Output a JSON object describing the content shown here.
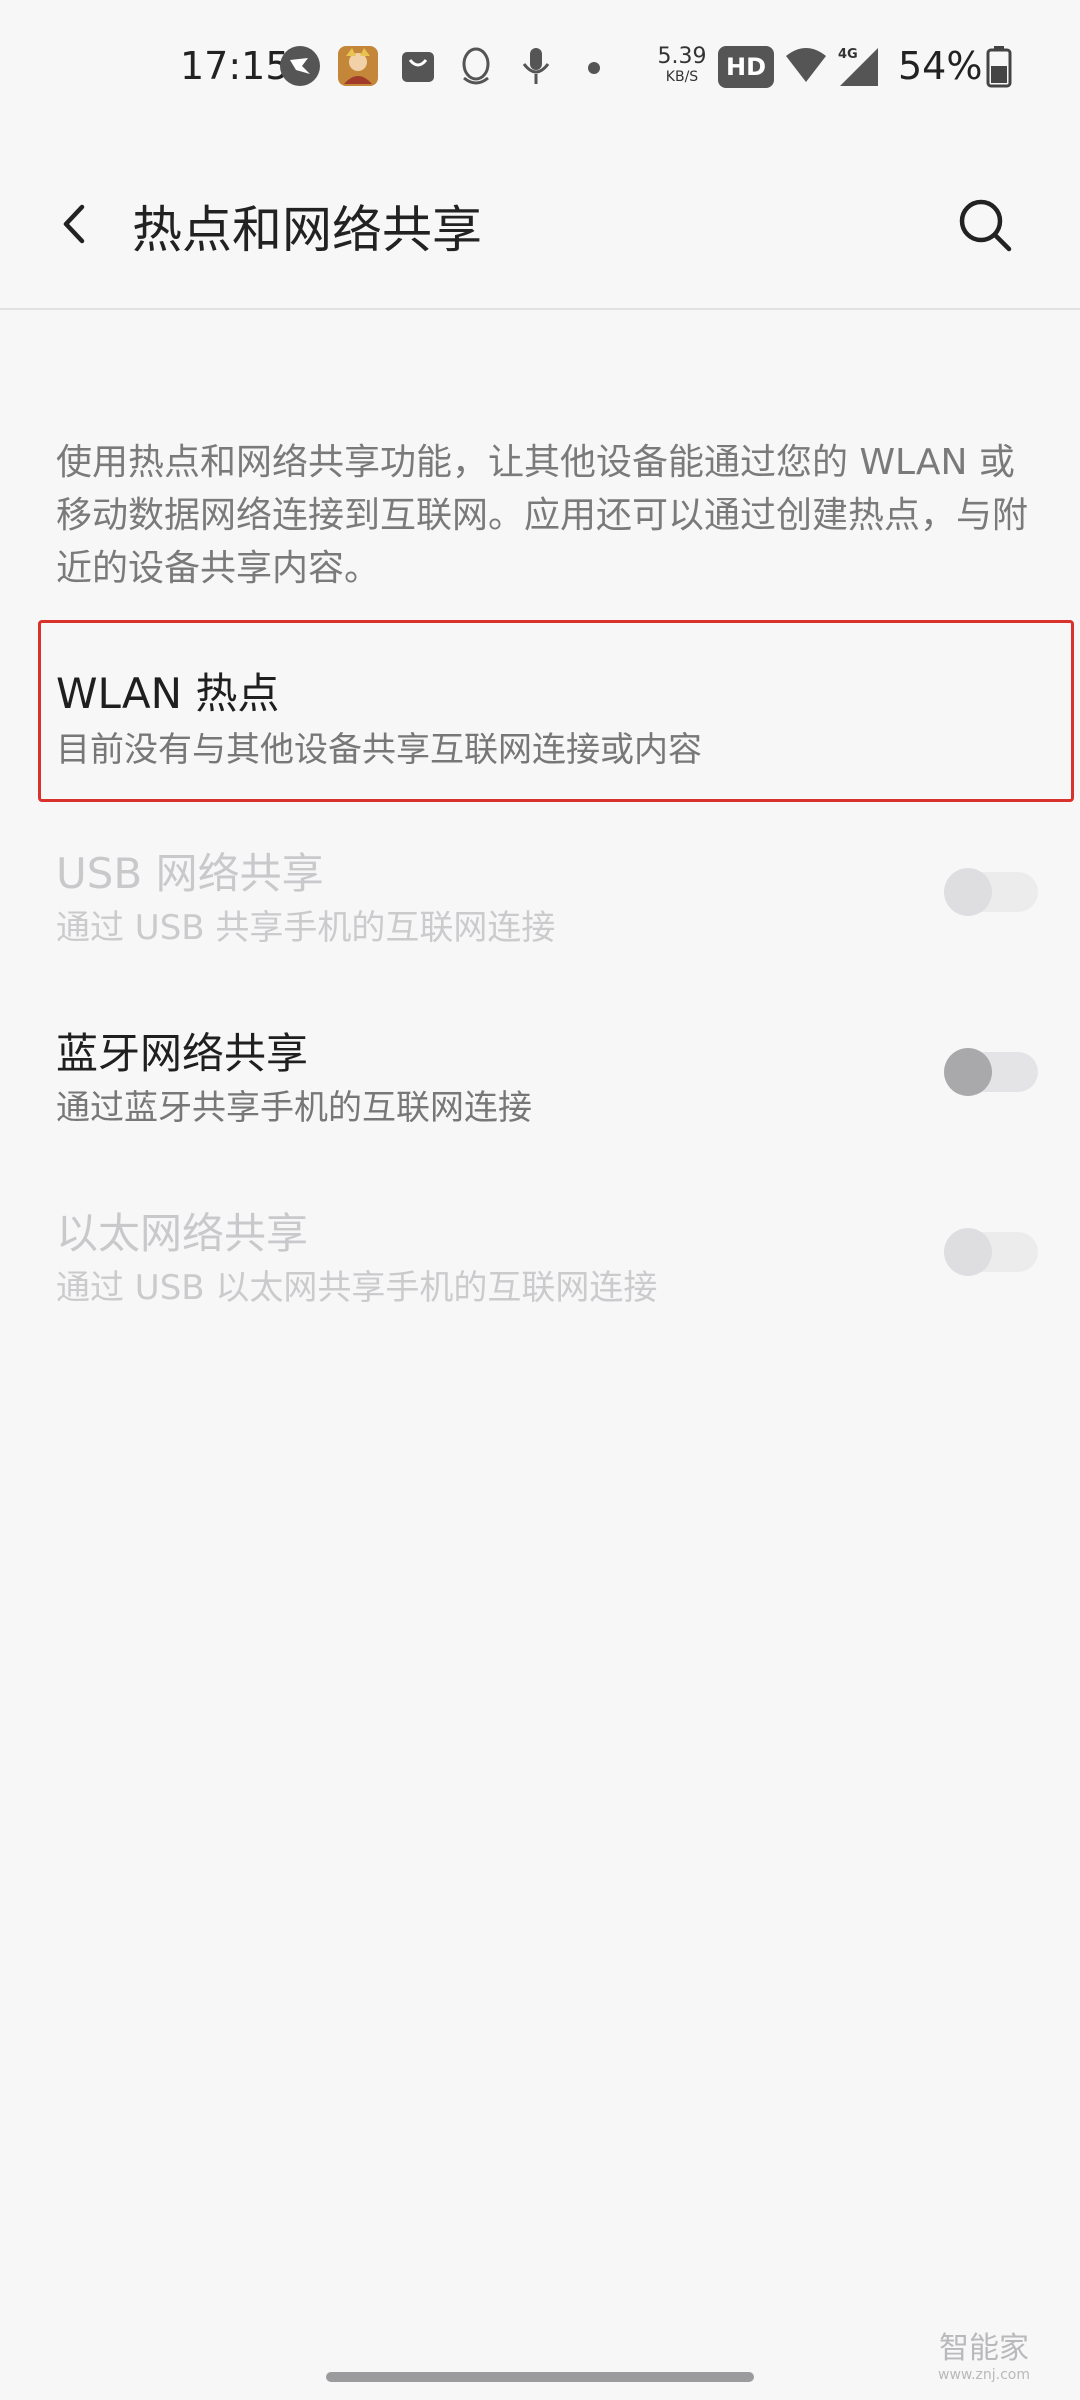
{
  "status_bar": {
    "time": "17:15",
    "icons": [
      "bird-app-icon",
      "game-avatar-icon",
      "shopping-bag-icon",
      "qq-icon",
      "microphone-icon"
    ],
    "net_speed_value": "5.39",
    "net_speed_unit": "KB/S",
    "hd_badge": "HD",
    "signal_label": "4G",
    "battery_percent": "54%"
  },
  "app_bar": {
    "title": "热点和网络共享",
    "back_icon": "back-arrow-icon",
    "search_icon": "search-icon"
  },
  "description": "使用热点和网络共享功能，让其他设备能通过您的 WLAN 或移动数据网络连接到互联网。应用还可以通过创建热点，与附近的设备共享内容。",
  "items": [
    {
      "title": "WLAN 热点",
      "subtitle": "目前没有与其他设备共享互联网连接或内容",
      "enabled": true,
      "toggle": false
    },
    {
      "title": "USB 网络共享",
      "subtitle": "通过 USB 共享手机的互联网连接",
      "enabled": false,
      "toggle": true,
      "toggle_on": false
    },
    {
      "title": "蓝牙网络共享",
      "subtitle": "通过蓝牙共享手机的互联网连接",
      "enabled": true,
      "toggle": true,
      "toggle_on": false
    },
    {
      "title": "以太网络共享",
      "subtitle": "通过 USB 以太网共享手机的互联网连接",
      "enabled": false,
      "toggle": true,
      "toggle_on": false
    }
  ],
  "watermark": {
    "main": "智能家",
    "sub": "www.znj.com"
  },
  "colors": {
    "background": "#f7f7f8",
    "highlight_border": "#d9312b",
    "title_text": "#1f1f1f",
    "disabled_text": "#c9c9cb"
  }
}
